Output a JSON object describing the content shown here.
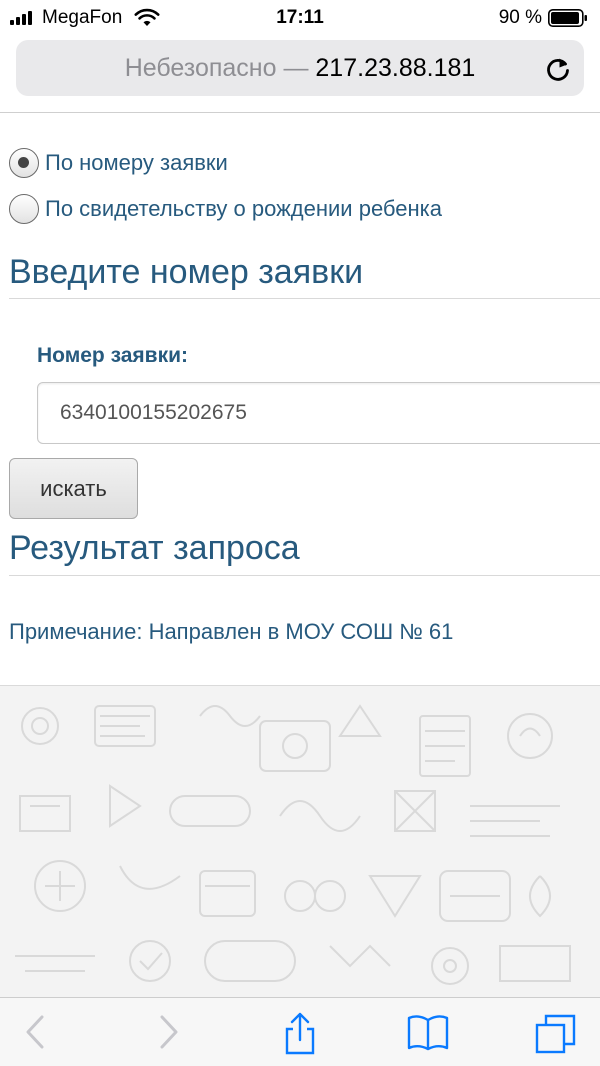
{
  "status": {
    "carrier": "MegaFon",
    "time": "17:11",
    "battery": "90 %"
  },
  "address": {
    "insecure": "Небезопасно — ",
    "host": "217.23.88.181"
  },
  "form": {
    "radio_options": [
      {
        "label": "По номеру заявки",
        "checked": true
      },
      {
        "label": "По свидетельству о рождении ребенка",
        "checked": false
      }
    ],
    "section_title": "Введите номер заявки",
    "field_label": "Номер заявки:",
    "field_value": "6340100155202675",
    "search_button": "искать"
  },
  "result": {
    "title": "Результат запроса",
    "note": "Примечание: Направлен в МОУ СОШ № 61"
  },
  "icons": {
    "reload": "reload-icon",
    "back": "chevron-left-icon",
    "forward": "chevron-right-icon",
    "share": "share-icon",
    "bookmarks": "book-icon",
    "tabs": "tabs-icon"
  },
  "colors": {
    "link_text": "#275a7e",
    "toolbar_icon": "#0a7aff",
    "toolbar_disabled": "#c7c7cc"
  }
}
